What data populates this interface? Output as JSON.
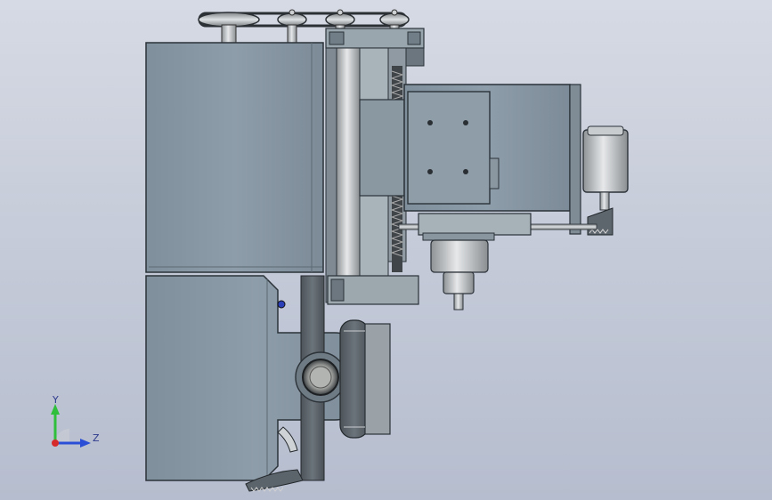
{
  "viewport": {
    "background_top": "#d6dae4",
    "background_bottom": "#b6bdce"
  },
  "model": {
    "body_color": "#8797a3",
    "body_edge": "#2b3238",
    "steel_color": "#b9bcbf",
    "dark_part": "#5e666d"
  },
  "triad": {
    "y_label": "Y",
    "z_label": "Z",
    "y_color": "#2fbf3a",
    "z_color": "#2a4fd6",
    "x_color": "#d62a2a"
  }
}
